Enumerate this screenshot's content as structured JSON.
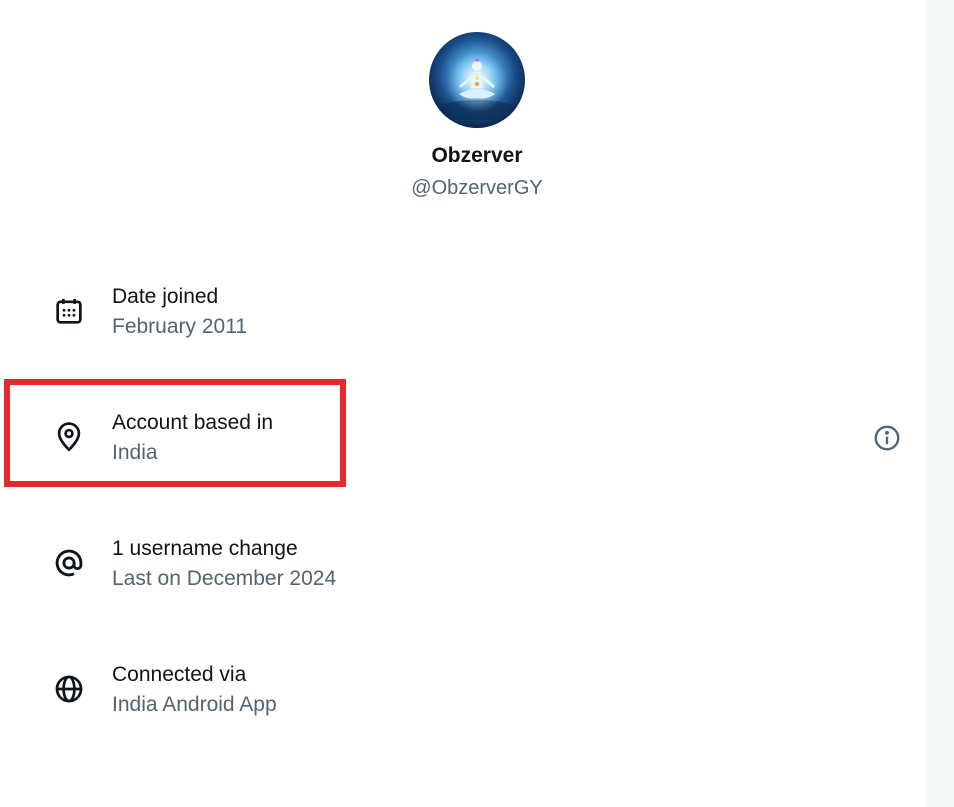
{
  "profile": {
    "display_name": "Obzerver",
    "handle": "@ObzerverGY"
  },
  "about_rows": [
    {
      "icon": "calendar-icon",
      "title": "Date joined",
      "value": "February 2011"
    },
    {
      "icon": "location-pin-icon",
      "title": "Account based in",
      "value": "India"
    },
    {
      "icon": "at-sign-icon",
      "title": "1 username change",
      "value": "Last on December 2024"
    },
    {
      "icon": "globe-icon",
      "title": "Connected via",
      "value": "India Android App"
    }
  ],
  "colors": {
    "text_primary": "#0f1419",
    "text_secondary": "#536471",
    "highlight_border": "#e8272f",
    "background": "#ffffff"
  }
}
